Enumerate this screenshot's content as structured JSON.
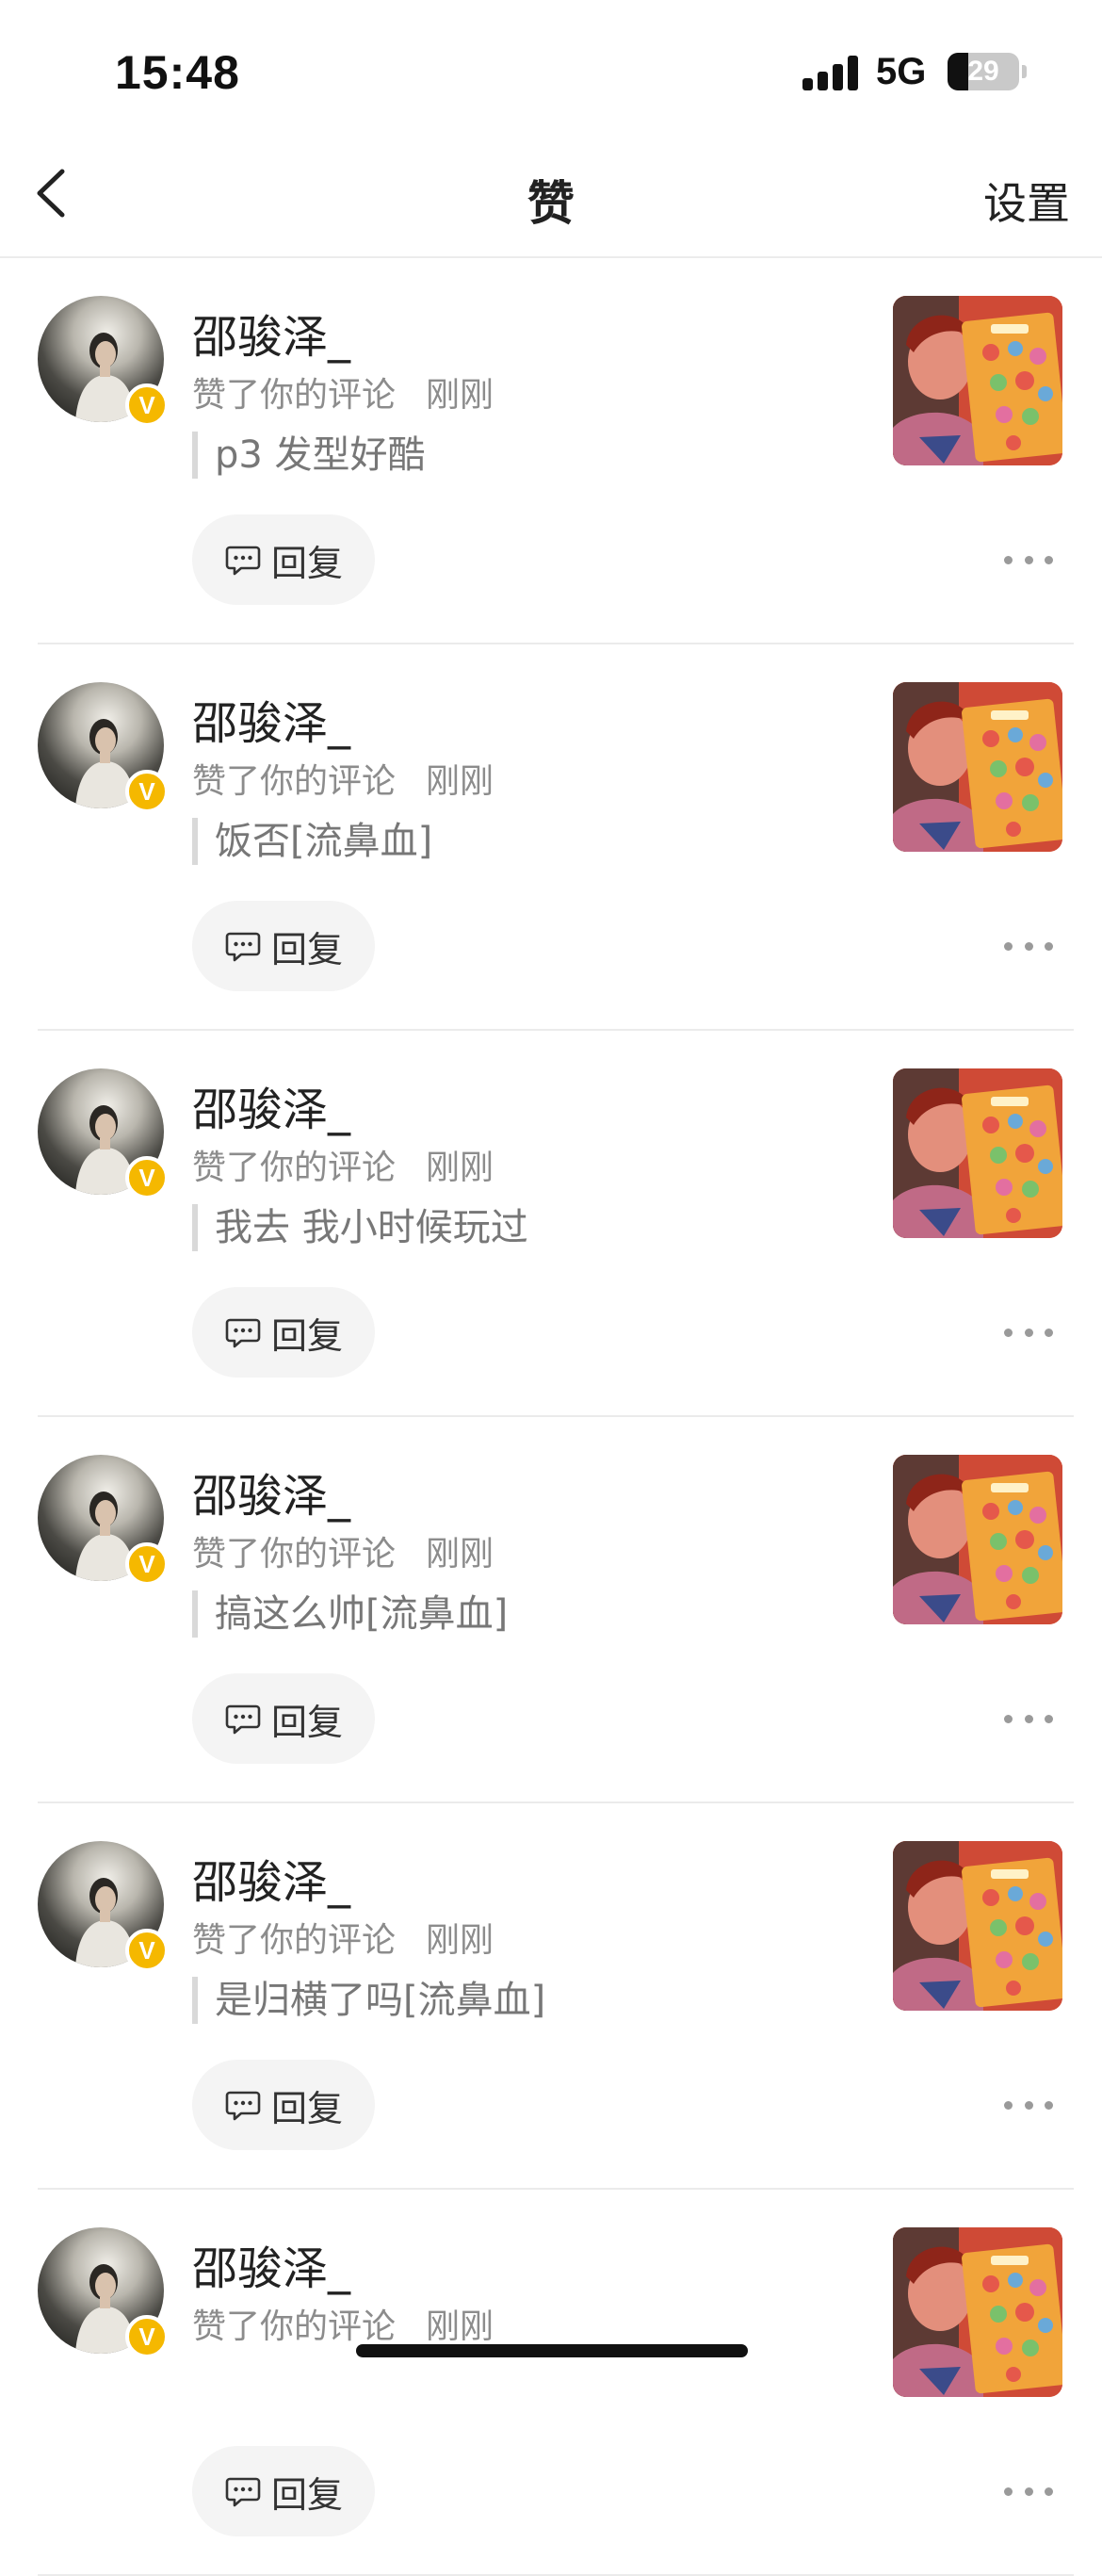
{
  "status_bar": {
    "time": "15:48",
    "network": "5G",
    "battery_level": "29",
    "battery_fraction": 0.29,
    "signal_bars": 4
  },
  "nav": {
    "back_icon": "chevron-left-icon",
    "title": "赞",
    "settings_label": "设置"
  },
  "colors": {
    "verified_badge": "#f5b800",
    "reply_button_bg": "#f4f4f4",
    "meta_text": "#8c8c8c",
    "comment_text": "#777777"
  },
  "notifications": [
    {
      "user_name": "邵骏泽_",
      "verified_badge": "V",
      "action": "赞了你的评论",
      "time": "刚刚",
      "comment": "p3 发型好酷",
      "reply_label": "回复",
      "reply_icon": "comment-bubble-icon",
      "more_icon": "more-horizontal-icon"
    },
    {
      "user_name": "邵骏泽_",
      "verified_badge": "V",
      "action": "赞了你的评论",
      "time": "刚刚",
      "comment": "饭否[流鼻血]",
      "reply_label": "回复",
      "reply_icon": "comment-bubble-icon",
      "more_icon": "more-horizontal-icon"
    },
    {
      "user_name": "邵骏泽_",
      "verified_badge": "V",
      "action": "赞了你的评论",
      "time": "刚刚",
      "comment": "我去 我小时候玩过",
      "reply_label": "回复",
      "reply_icon": "comment-bubble-icon",
      "more_icon": "more-horizontal-icon"
    },
    {
      "user_name": "邵骏泽_",
      "verified_badge": "V",
      "action": "赞了你的评论",
      "time": "刚刚",
      "comment": "搞这么帅[流鼻血]",
      "reply_label": "回复",
      "reply_icon": "comment-bubble-icon",
      "more_icon": "more-horizontal-icon"
    },
    {
      "user_name": "邵骏泽_",
      "verified_badge": "V",
      "action": "赞了你的评论",
      "time": "刚刚",
      "comment": "是归横了吗[流鼻血]",
      "reply_label": "回复",
      "reply_icon": "comment-bubble-icon",
      "more_icon": "more-horizontal-icon"
    },
    {
      "user_name": "邵骏泽_",
      "verified_badge": "V",
      "action": "赞了你的评论",
      "time": "刚刚",
      "comment": "",
      "reply_label": "回复",
      "reply_icon": "comment-bubble-icon",
      "more_icon": "more-horizontal-icon"
    }
  ]
}
